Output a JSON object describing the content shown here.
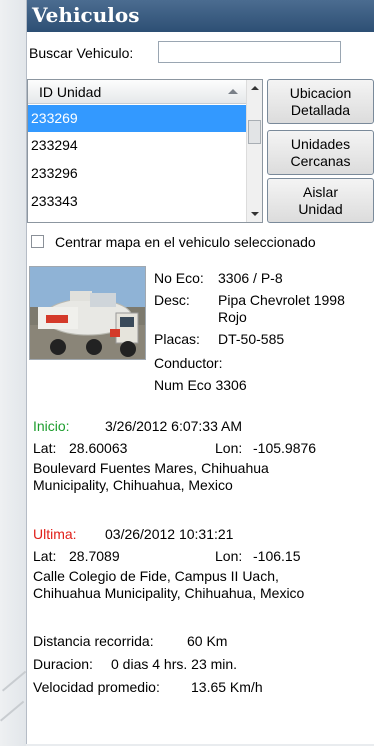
{
  "window": {
    "title": "Vehiculos"
  },
  "search": {
    "label": "Buscar Vehiculo:",
    "value": ""
  },
  "list": {
    "column_header": "ID Unidad",
    "rows": [
      "233269",
      "233294",
      "233296",
      "233343"
    ],
    "selected_index": 0
  },
  "buttons": {
    "ubicacion_line1": "Ubicacion",
    "ubicacion_line2": "Detallada",
    "cercanas_line1": "Unidades",
    "cercanas_line2": "Cercanas",
    "aislar_line1": "Aislar",
    "aislar_line2": "Unidad"
  },
  "center_checkbox": {
    "label": "Centrar mapa en el vehiculo seleccionado",
    "checked": false
  },
  "vehicle": {
    "no_eco_label": "No Eco:",
    "no_eco_value": "3306 / P-8",
    "desc_label": "Desc:",
    "desc_line1": "Pipa Chevrolet 1998",
    "desc_line2": "Rojo",
    "placas_label": "Placas:",
    "placas_value": "DT-50-585",
    "conductor_label": "Conductor:",
    "conductor_value": "Num Eco 3306"
  },
  "inicio": {
    "label": "Inicio:",
    "datetime": "3/26/2012 6:07:33 AM",
    "lat_label": "Lat:",
    "lat": "28.60063",
    "lon_label": "Lon:",
    "lon": "-105.9876",
    "address_line1": "Boulevard Fuentes Mares, Chihuahua",
    "address_line2": "Municipality, Chihuahua, Mexico"
  },
  "ultima": {
    "label": "Ultima:",
    "datetime": "03/26/2012 10:31:21",
    "lat_label": "Lat:",
    "lat": "28.7089",
    "lon_label": "Lon:",
    "lon": "-106.15",
    "address_line1": "Calle Colegio de Fide, Campus II Uach,",
    "address_line2": "Chihuahua Municipality, Chihuahua, Mexico"
  },
  "summary": {
    "distancia_label": "Distancia recorrida:",
    "distancia_value": "60 Km",
    "duracion_label": "Duracion:",
    "duracion_value": "0 dias 4 hrs. 23 min.",
    "velocidad_label": "Velocidad promedio:",
    "velocidad_value": "13.65 Km/h"
  },
  "colors": {
    "title_bar": "#3a5b80",
    "selected_row": "#3399ff",
    "label_blue": "#1a3fcf",
    "inicio_green": "#1c9d2d",
    "ultima_red": "#e0201a"
  },
  "icons": [
    "sort-ascending-icon",
    "scroll-up-icon",
    "scroll-down-icon",
    "checkbox-icon"
  ]
}
